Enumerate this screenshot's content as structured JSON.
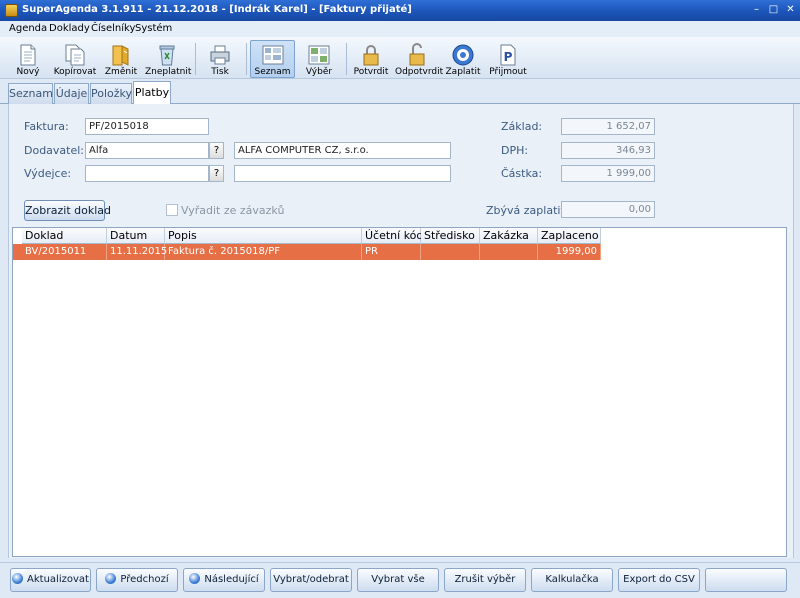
{
  "window": {
    "title": "SuperAgenda 3.1.911 - 21.12.2018 - [Indrák Karel] - [Faktury přijaté]",
    "controls": {
      "minimize": "–",
      "maximize": "□",
      "close": "✕"
    }
  },
  "menu": [
    "Agenda",
    "Doklady",
    "Číselníky",
    "Systém"
  ],
  "toolbar": {
    "novy": "Nový",
    "kopirovat": "Kopírovat",
    "zmenit": "Změnit",
    "zneplatnit": "Zneplatnit",
    "tisk": "Tisk",
    "seznam": "Seznam",
    "vyber": "Výběr",
    "potvrdit": "Potvrdit",
    "odpotvrdit": "Odpotvrdit",
    "zaplatit": "Zaplatit",
    "prijmout": "Přijmout",
    "prijmout_glyph": "P",
    "active_view": "Seznam"
  },
  "tabs": [
    "Seznam",
    "Údaje",
    "Položky",
    "Platby"
  ],
  "selected_tab": "Platby",
  "form": {
    "faktura_label": "Faktura:",
    "faktura_value": "PF/2015018",
    "dodavatel_label": "Dodavatel:",
    "dodavatel_code": "Alfa",
    "dodavatel_name": "ALFA COMPUTER CZ, s.r.o.",
    "vydejce_label": "Výdejce:",
    "vydejce_code": "",
    "vydejce_name": "",
    "lookup": "?",
    "zaklad_label": "Základ:",
    "zaklad_value": "1 652,07",
    "dph_label": "DPH:",
    "dph_value": "346,93",
    "castka_label": "Částka:",
    "castka_value": "1 999,00",
    "zbyva_label": "Zbývá zaplatit:",
    "zbyva_value": "0,00",
    "zobrazit_button": "Zobrazit doklad",
    "vyradit_label": "Vyřadit ze závazků",
    "vyradit_checked": false
  },
  "grid": {
    "columns": [
      "Doklad",
      "Datum",
      "Popis",
      "Účetní kód",
      "Středisko",
      "Zakázka",
      "Zaplaceno"
    ],
    "rows": [
      [
        "BV/2015011",
        "11.11.2015",
        "Faktura č. 2015018/PF",
        "PR",
        "",
        "",
        "1999,00"
      ]
    ],
    "selection_color": "#e66f45"
  },
  "bottom": {
    "aktualizovat": "Aktualizovat",
    "predchozi": "Předchozí",
    "nasledujici": "Následující",
    "vybrat_odebrat": "Vybrat/odebrat",
    "vybrat_vse": "Vybrat vše",
    "zrusit_vyber": "Zrušit výběr",
    "kalkulacka": "Kalkulačka",
    "export": "Export do CSV",
    "empty": ""
  }
}
